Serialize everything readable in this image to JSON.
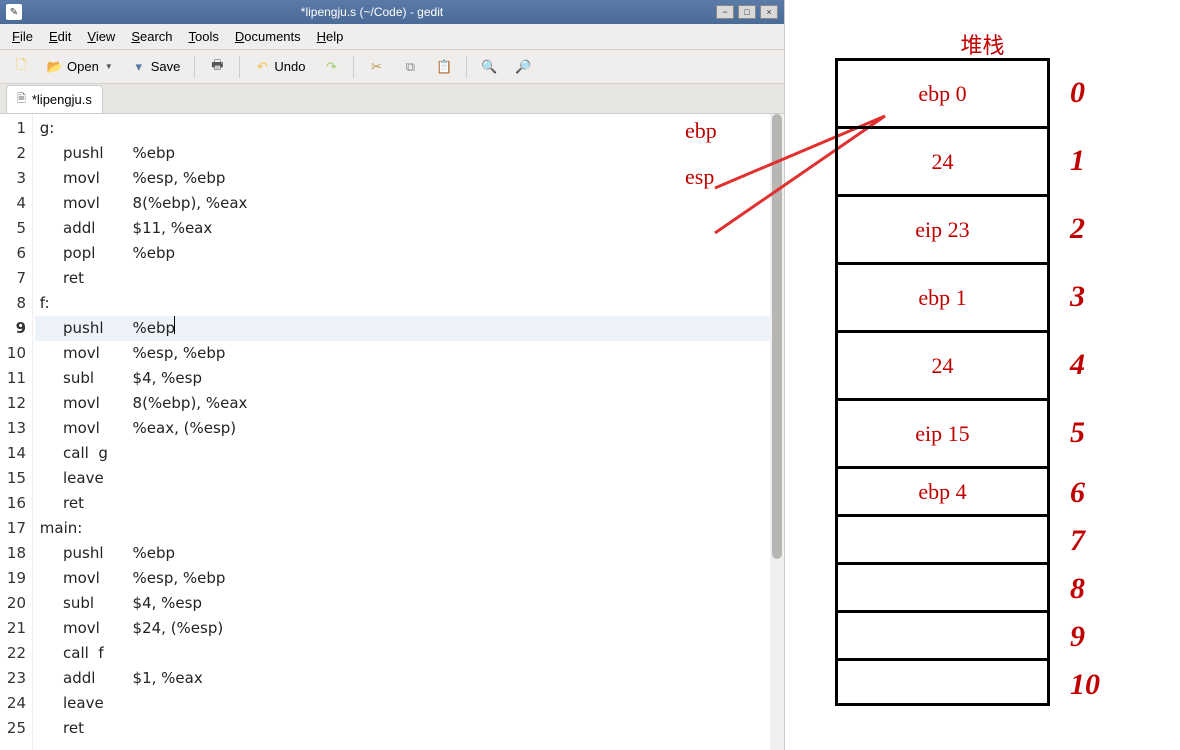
{
  "window": {
    "title": "*lipengju.s (~/Code) - gedit"
  },
  "menus": [
    "File",
    "Edit",
    "View",
    "Search",
    "Tools",
    "Documents",
    "Help"
  ],
  "toolbar": {
    "open": "Open",
    "save": "Save",
    "undo": "Undo"
  },
  "tab": {
    "label": "*lipengju.s"
  },
  "code_lines": [
    {
      "n": 1,
      "label": "g:",
      "mn": "",
      "args": ""
    },
    {
      "n": 2,
      "label": "",
      "mn": "pushl",
      "args": "%ebp"
    },
    {
      "n": 3,
      "label": "",
      "mn": "movl",
      "args": "%esp, %ebp"
    },
    {
      "n": 4,
      "label": "",
      "mn": "movl",
      "args": "8(%ebp), %eax"
    },
    {
      "n": 5,
      "label": "",
      "mn": "addl",
      "args": "$11, %eax"
    },
    {
      "n": 6,
      "label": "",
      "mn": "popl",
      "args": "%ebp"
    },
    {
      "n": 7,
      "label": "",
      "mn": "ret",
      "args": ""
    },
    {
      "n": 8,
      "label": "f:",
      "mn": "",
      "args": ""
    },
    {
      "n": 9,
      "label": "",
      "mn": "pushl",
      "args": "%ebp",
      "hl": true,
      "cursor": true
    },
    {
      "n": 10,
      "label": "",
      "mn": "movl",
      "args": "%esp, %ebp"
    },
    {
      "n": 11,
      "label": "",
      "mn": "subl",
      "args": "$4, %esp"
    },
    {
      "n": 12,
      "label": "",
      "mn": "movl",
      "args": "8(%ebp), %eax"
    },
    {
      "n": 13,
      "label": "",
      "mn": "movl",
      "args": "%eax, (%esp)"
    },
    {
      "n": 14,
      "label": "",
      "mn": "call",
      "args": "g",
      "tight": true
    },
    {
      "n": 15,
      "label": "",
      "mn": "leave",
      "args": ""
    },
    {
      "n": 16,
      "label": "",
      "mn": "ret",
      "args": ""
    },
    {
      "n": 17,
      "label": "main:",
      "mn": "",
      "args": ""
    },
    {
      "n": 18,
      "label": "",
      "mn": "pushl",
      "args": "%ebp"
    },
    {
      "n": 19,
      "label": "",
      "mn": "movl",
      "args": "%esp, %ebp"
    },
    {
      "n": 20,
      "label": "",
      "mn": "subl",
      "args": "$4, %esp"
    },
    {
      "n": 21,
      "label": "",
      "mn": "movl",
      "args": "$24, (%esp)"
    },
    {
      "n": 22,
      "label": "",
      "mn": "call",
      "args": "f",
      "tight": true
    },
    {
      "n": 23,
      "label": "",
      "mn": "addl",
      "args": "$1, %eax"
    },
    {
      "n": 24,
      "label": "",
      "mn": "leave",
      "args": ""
    },
    {
      "n": 25,
      "label": "",
      "mn": "ret",
      "args": ""
    }
  ],
  "diagram": {
    "title": "堆栈",
    "pointers": {
      "ebp": "ebp",
      "esp": "esp"
    },
    "rows": [
      {
        "text": "ebp 0",
        "idx": "0"
      },
      {
        "text": "24",
        "idx": "1"
      },
      {
        "text": "eip 23",
        "idx": "2"
      },
      {
        "text": "ebp 1",
        "idx": "3"
      },
      {
        "text": "24",
        "idx": "4"
      },
      {
        "text": "eip 15",
        "idx": "5"
      },
      {
        "text": "ebp 4",
        "idx": "6"
      },
      {
        "text": "",
        "idx": "7"
      },
      {
        "text": "",
        "idx": "8"
      },
      {
        "text": "",
        "idx": "9"
      },
      {
        "text": "",
        "idx": "10"
      }
    ]
  }
}
